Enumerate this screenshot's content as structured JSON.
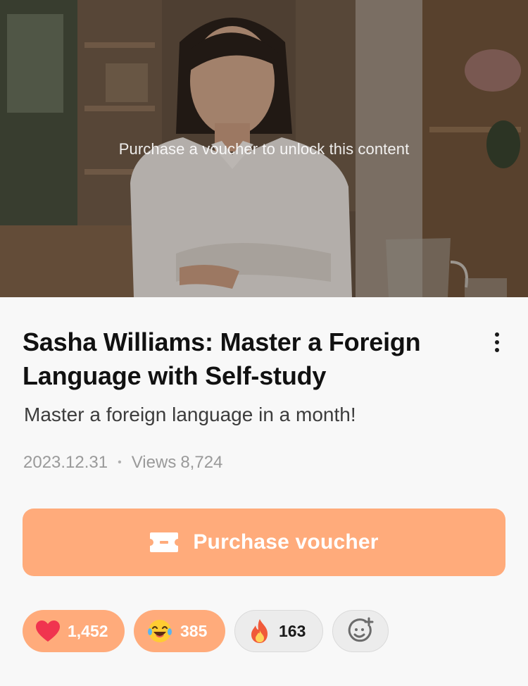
{
  "hero": {
    "lock_message": "Purchase a voucher to unlock this content"
  },
  "post": {
    "title": "Sasha Williams: Master a Foreign Language with Self-study",
    "subtitle": "Master a foreign language in a month!",
    "date": "2023.12.31",
    "views_label": "Views",
    "views_count": "8,724"
  },
  "purchase": {
    "label": "Purchase voucher",
    "icon": "ticket-icon"
  },
  "reactions": [
    {
      "icon": "heart-icon",
      "count": "1,452",
      "active": true
    },
    {
      "icon": "laughing-emoji-icon",
      "count": "385",
      "active": true
    },
    {
      "icon": "fire-icon",
      "count": "163",
      "active": false
    },
    {
      "icon": "add-reaction-icon",
      "count": "",
      "active": false
    }
  ],
  "colors": {
    "accent": "#ffab7b",
    "heart": "#f0344f",
    "fire": "#f05a3a",
    "background": "#f8f8f8"
  }
}
